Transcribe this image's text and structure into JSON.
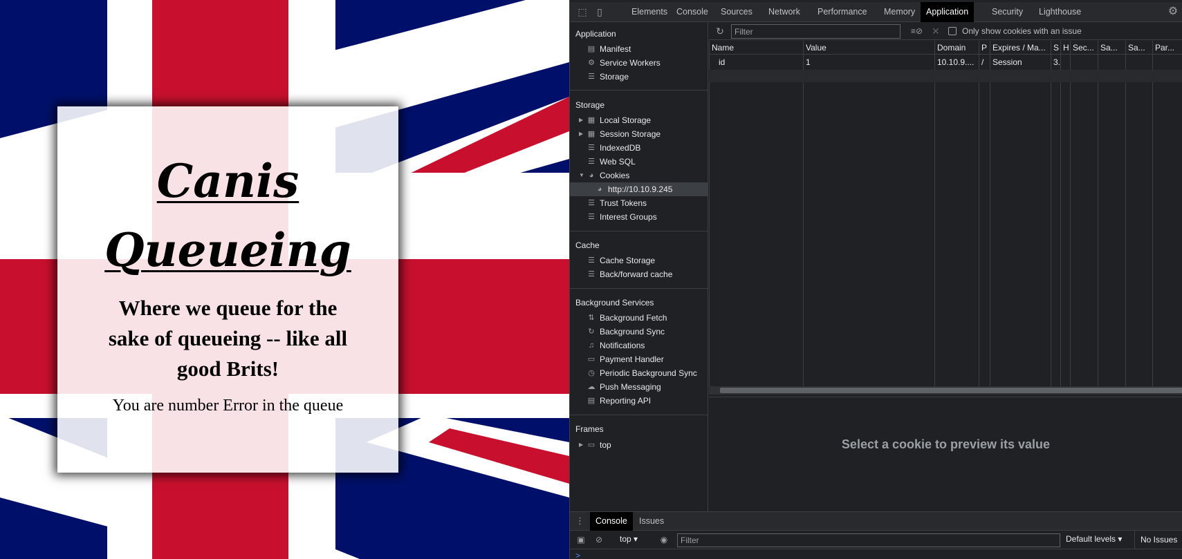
{
  "page": {
    "title": "Canis Queueing",
    "subtitle": "Where we queue for the sake of queueing -- like all good Brits!",
    "status": "You are number Error in the queue"
  },
  "devtools": {
    "tabs": [
      "Elements",
      "Console",
      "Sources",
      "Network",
      "Performance",
      "Memory",
      "Application",
      "Security",
      "Lighthouse"
    ],
    "active_tab": "Application",
    "sidebar": {
      "application": {
        "title": "Application",
        "items": [
          "Manifest",
          "Service Workers",
          "Storage"
        ]
      },
      "storage": {
        "title": "Storage",
        "items": [
          "Local Storage",
          "Session Storage",
          "IndexedDB",
          "Web SQL",
          "Cookies",
          "http://10.10.9.245",
          "Trust Tokens",
          "Interest Groups"
        ]
      },
      "cache": {
        "title": "Cache",
        "items": [
          "Cache Storage",
          "Back/forward cache"
        ]
      },
      "background_services": {
        "title": "Background Services",
        "items": [
          "Background Fetch",
          "Background Sync",
          "Notifications",
          "Payment Handler",
          "Periodic Background Sync",
          "Push Messaging",
          "Reporting API"
        ]
      },
      "frames": {
        "title": "Frames",
        "items": [
          "top"
        ]
      }
    },
    "cookies": {
      "filter_placeholder": "Filter",
      "only_issue_label": "Only show cookies with an issue",
      "columns": [
        "Name",
        "Value",
        "Domain",
        "P",
        "Expires / Ma...",
        "S",
        "H",
        "Sec...",
        "Sa...",
        "Sa...",
        "Par..."
      ],
      "row": [
        "id",
        "1",
        "10.10.9....",
        "/",
        "Session",
        "3.",
        "",
        "",
        "",
        "",
        ""
      ],
      "preview_message": "Select a cookie to preview its value"
    },
    "drawer": {
      "tabs": [
        "Console",
        "Issues"
      ],
      "context": "top",
      "filter_placeholder": "Filter",
      "levels": "Default levels",
      "issues": "No Issues",
      "prompt": ">"
    }
  }
}
